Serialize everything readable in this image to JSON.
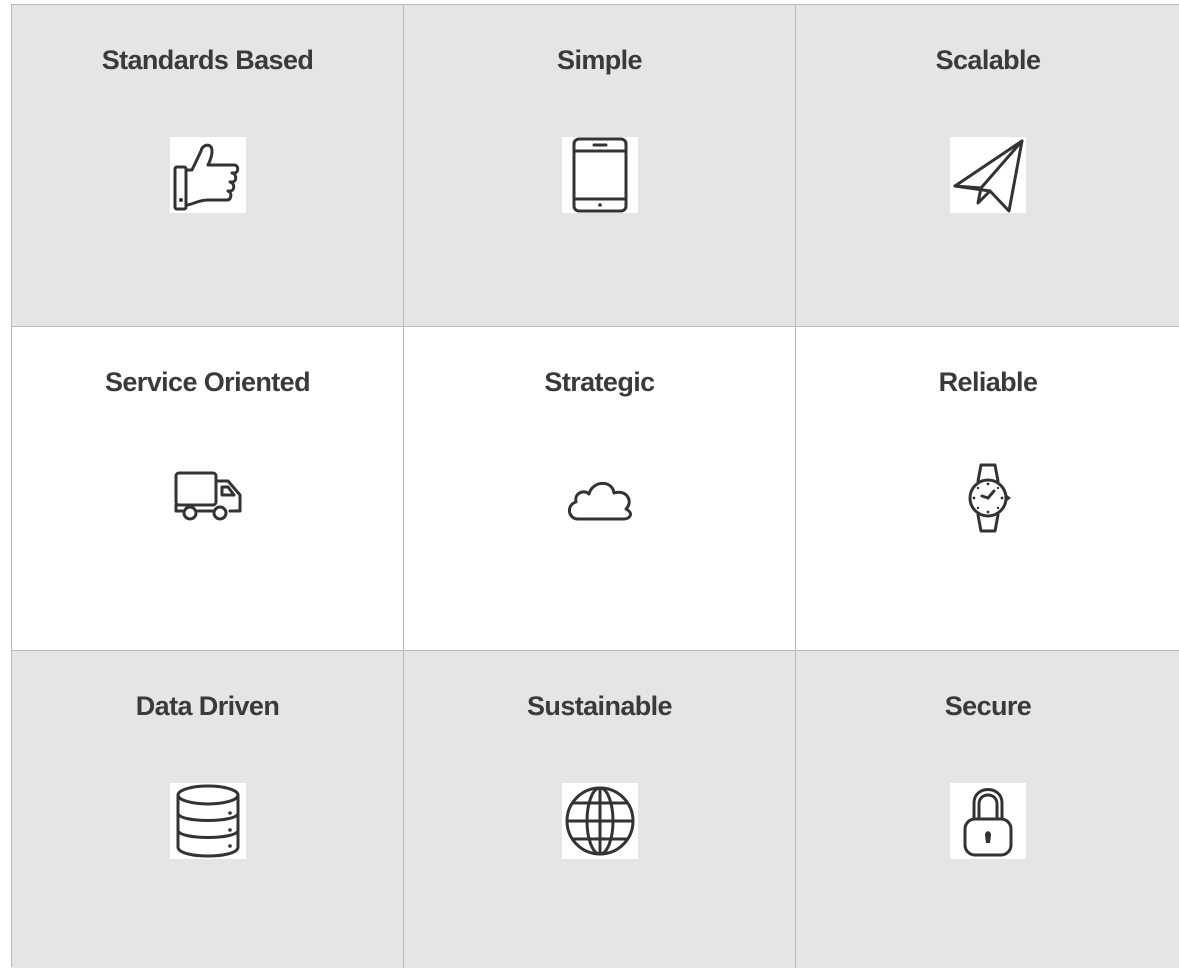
{
  "features": {
    "standards_based": {
      "title": "Standards Based",
      "icon": "thumbs-up-icon"
    },
    "simple": {
      "title": "Simple",
      "icon": "tablet-icon"
    },
    "scalable": {
      "title": "Scalable",
      "icon": "paper-plane-icon"
    },
    "service_oriented": {
      "title": "Service Oriented",
      "icon": "truck-icon"
    },
    "strategic": {
      "title": "Strategic",
      "icon": "cloud-icon"
    },
    "reliable": {
      "title": "Reliable",
      "icon": "wristwatch-icon"
    },
    "data_driven": {
      "title": "Data Driven",
      "icon": "database-icon"
    },
    "sustainable": {
      "title": "Sustainable",
      "icon": "globe-icon"
    },
    "secure": {
      "title": "Secure",
      "icon": "padlock-icon"
    }
  },
  "colors": {
    "cell_grey": "#e5e5e5",
    "cell_white": "#ffffff",
    "grid_line": "#b9b9b9",
    "text": "#3a3a3a",
    "icon_stroke": "#333333"
  }
}
